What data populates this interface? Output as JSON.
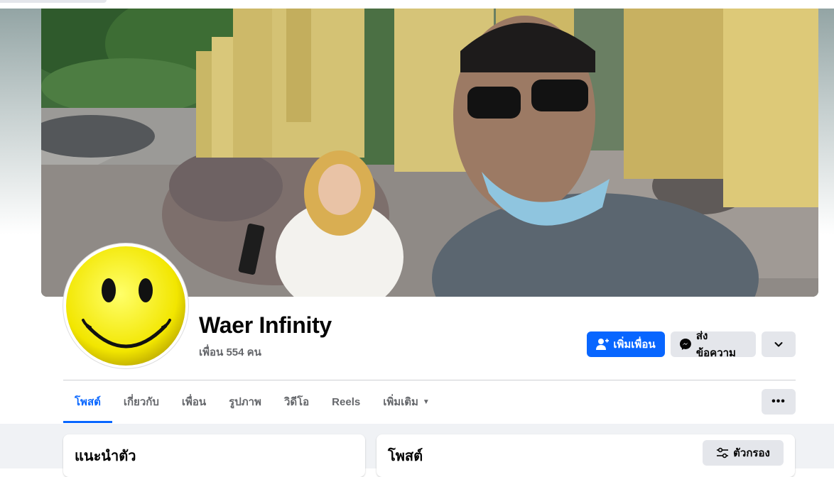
{
  "profile": {
    "name": "Waer Infinity",
    "friends_count": "เพื่อน 554 คน"
  },
  "actions": {
    "add_friend": "เพิ่มเพื่อน",
    "message": "ส่งข้อความ"
  },
  "tabs": [
    {
      "label": "โพสต์",
      "active": true
    },
    {
      "label": "เกี่ยวกับ"
    },
    {
      "label": "เพื่อน"
    },
    {
      "label": "รูปภาพ"
    },
    {
      "label": "วิดีโอ"
    },
    {
      "label": "Reels"
    },
    {
      "label": "เพิ่มเติม"
    }
  ],
  "cards": {
    "intro_title": "แนะนำตัว",
    "posts_title": "โพสต์",
    "filter_label": "ตัวกรอง"
  },
  "colors": {
    "accent": "#0866ff",
    "secondary_button": "#e4e6eb",
    "page_background": "#f0f2f5",
    "muted_text": "#65676b"
  },
  "icons": {
    "add_friend": "person-plus-icon",
    "message": "messenger-icon",
    "expand": "chevron-down-icon",
    "more": "more-dots-icon",
    "filter": "sliders-icon",
    "dropdown": "caret-down-icon"
  }
}
